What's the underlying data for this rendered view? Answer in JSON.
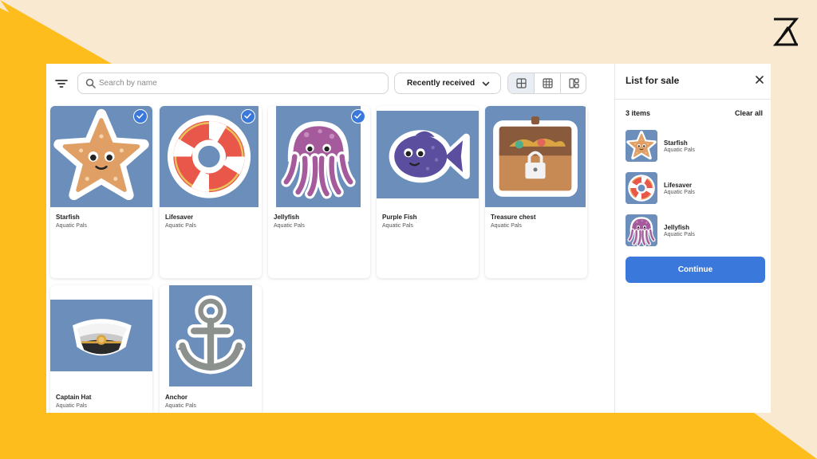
{
  "colors": {
    "background": "#FAE9D1",
    "yellow": "#FDBD1C",
    "accent": "#3B78DB",
    "thumb_bg": "#6B8EBB"
  },
  "toolbar": {
    "filter_icon": "filter-icon",
    "search_placeholder": "Search by name",
    "search_value": "",
    "sort_label": "Recently received",
    "views": [
      "grid-large-icon",
      "grid-small-icon",
      "layout-mixed-icon"
    ],
    "active_view": 0
  },
  "items": [
    {
      "title": "Starfish",
      "subtitle": "Aquatic Pals",
      "icon": "starfish",
      "selected": true
    },
    {
      "title": "Lifesaver",
      "subtitle": "Aquatic Pals",
      "icon": "lifesaver",
      "selected": true
    },
    {
      "title": "Jellyfish",
      "subtitle": "Aquatic Pals",
      "icon": "jellyfish",
      "selected": true
    },
    {
      "title": "Purple Fish",
      "subtitle": "Aquatic Pals",
      "icon": "purple-fish",
      "selected": false
    },
    {
      "title": "Treasure chest",
      "subtitle": "Aquatic Pals",
      "icon": "treasure-chest",
      "selected": false
    },
    {
      "title": "Captain Hat",
      "subtitle": "Aquatic Pals",
      "icon": "captain-hat",
      "selected": false
    },
    {
      "title": "Anchor",
      "subtitle": "Aquatic Pals",
      "icon": "anchor",
      "selected": false
    }
  ],
  "sidebar": {
    "title": "List for sale",
    "count_label": "3 items",
    "clear_label": "Clear all",
    "selected": [
      {
        "title": "Starfish",
        "subtitle": "Aquatic Pals",
        "icon": "starfish"
      },
      {
        "title": "Lifesaver",
        "subtitle": "Aquatic Pals",
        "icon": "lifesaver"
      },
      {
        "title": "Jellyfish",
        "subtitle": "Aquatic Pals",
        "icon": "jellyfish"
      }
    ],
    "continue_label": "Continue"
  }
}
